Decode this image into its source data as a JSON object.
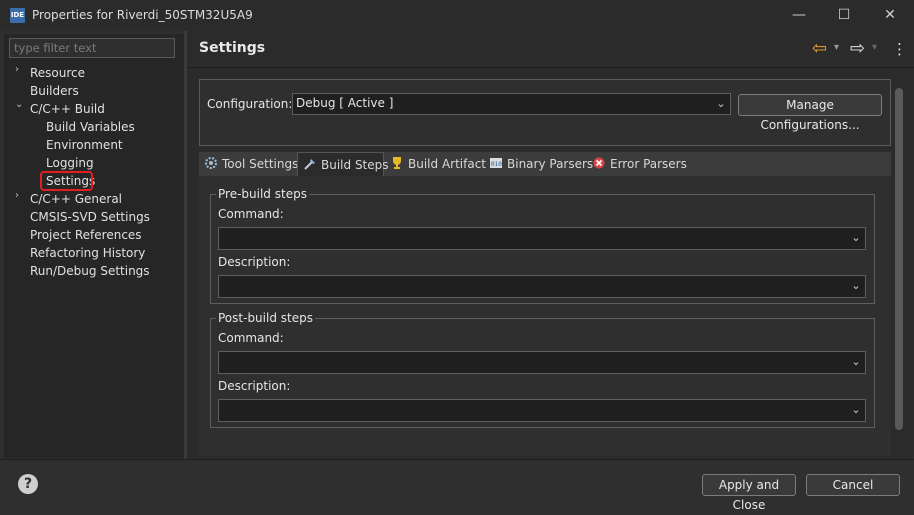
{
  "window": {
    "icon_text": "IDE",
    "title": "Properties for Riverdi_50STM32U5A9",
    "min_glyph": "—",
    "max_glyph": "☐",
    "close_glyph": "✕"
  },
  "filter": {
    "placeholder": "type filter text"
  },
  "tree": {
    "expand_glyph": "›",
    "collapse_glyph": "⌄",
    "items": [
      {
        "label": "Resource"
      },
      {
        "label": "Builders"
      },
      {
        "label": "C/C++ Build"
      },
      {
        "label": "Build Variables"
      },
      {
        "label": "Environment"
      },
      {
        "label": "Logging"
      },
      {
        "label": "Settings"
      },
      {
        "label": "C/C++ General"
      },
      {
        "label": "CMSIS-SVD Settings"
      },
      {
        "label": "Project References"
      },
      {
        "label": "Refactoring History"
      },
      {
        "label": "Run/Debug Settings"
      }
    ]
  },
  "page": {
    "title": "Settings",
    "nav": {
      "back_glyph": "⇦",
      "forward_glyph": "⇨",
      "dropdown_glyph": "▾",
      "menu_glyph": "⋮"
    }
  },
  "configuration": {
    "label": "Configuration:",
    "value": "Debug  [ Active ]",
    "manage_label": "Manage Configurations..."
  },
  "tabs": [
    {
      "label": "Tool Settings",
      "icon": "tool-settings-icon"
    },
    {
      "label": "Build Steps",
      "icon": "build-steps-icon"
    },
    {
      "label": "Build Artifact",
      "icon": "trophy-icon"
    },
    {
      "label": "Binary Parsers",
      "icon": "binary-icon"
    },
    {
      "label": "Error Parsers",
      "icon": "error-icon"
    }
  ],
  "prebuild": {
    "legend": "Pre-build steps",
    "command_label": "Command:",
    "command_value": "",
    "description_label": "Description:",
    "description_value": ""
  },
  "postbuild": {
    "legend": "Post-build steps",
    "command_label": "Command:",
    "command_value": "",
    "description_label": "Description:",
    "description_value": ""
  },
  "dropdown_glyph": "⌄",
  "footer": {
    "help_glyph": "?",
    "apply_close_label": "Apply and Close",
    "cancel_label": "Cancel"
  },
  "colors": {
    "highlight_outline": "#e02020",
    "accent_arrow": "#e8a33a"
  }
}
